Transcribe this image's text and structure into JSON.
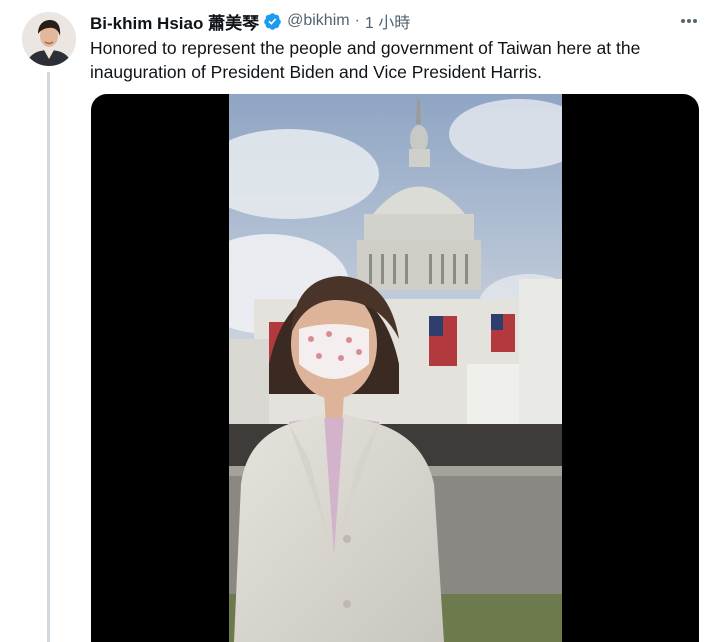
{
  "tweet": {
    "author_name": "Bi-khim Hsiao 蕭美琴",
    "handle": "@bikhim",
    "separator": "·",
    "timestamp": "1 小時",
    "text": "Honored to represent the people and government of Taiwan here at the inauguration of President Biden and Vice President Harris.",
    "verified": true
  },
  "icons": {
    "verified": "verified-badge-icon",
    "more": "more-options-icon"
  },
  "colors": {
    "text_primary": "#0f1419",
    "text_secondary": "#536471",
    "verified_blue": "#1d9bf0",
    "media_background": "#000000"
  }
}
